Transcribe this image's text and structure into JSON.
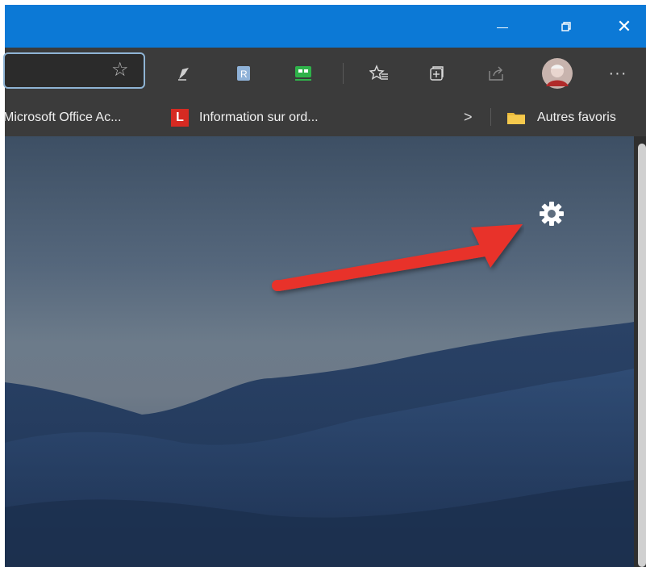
{
  "window": {
    "minimize_label": "—",
    "restore_icon": "restore-icon",
    "close_label": "✕"
  },
  "toolbar": {
    "address_placeholder": "",
    "more_label": "···",
    "icons": [
      "favorite-star-icon",
      "pen-extension-icon",
      "reader-extension-icon",
      "green-extension-icon",
      "favorites-list-icon",
      "collections-icon",
      "share-icon",
      "profile-avatar",
      "more-icon"
    ]
  },
  "favorites": {
    "item1": "Microsoft Office Ac...",
    "item2_badge": "L",
    "item2": "Information sur ord...",
    "chevron": ">",
    "other": "Autres favoris"
  },
  "colors": {
    "titlebar": "#0c79d6",
    "toolbar": "#3b3b3b",
    "arrow": "#e8332c"
  }
}
